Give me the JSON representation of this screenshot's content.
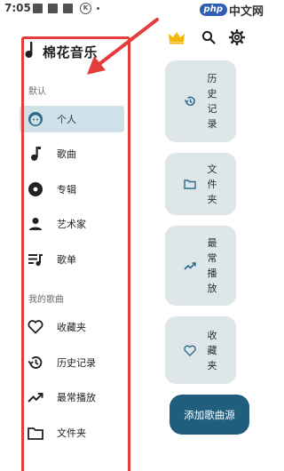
{
  "status_bar": {
    "time": "7:05",
    "notification_badge": "K"
  },
  "watermark": {
    "badge": "php",
    "text": "中文网"
  },
  "drawer": {
    "app_title": "棉花音乐",
    "default_section": "默认",
    "my_songs_section": "我的歌曲",
    "items": [
      {
        "label": "个人",
        "icon": "face-icon",
        "selected": true
      },
      {
        "label": "歌曲",
        "icon": "music-note-icon"
      },
      {
        "label": "专辑",
        "icon": "album-icon"
      },
      {
        "label": "艺术家",
        "icon": "person-icon"
      },
      {
        "label": "歌单",
        "icon": "playlist-icon"
      },
      {
        "label": "收藏夹",
        "icon": "heart-icon"
      },
      {
        "label": "历史记录",
        "icon": "history-icon"
      },
      {
        "label": "最常播放",
        "icon": "trending-icon"
      },
      {
        "label": "文件夹",
        "icon": "folder-icon"
      }
    ]
  },
  "toolbar": {
    "icons": [
      "crown-icon",
      "search-icon",
      "gear-icon"
    ]
  },
  "cards": [
    {
      "text": "历史记录",
      "icon": "history-icon"
    },
    {
      "text": "文件夹",
      "icon": "folder-icon"
    },
    {
      "text": "最常播放",
      "icon": "trending-icon"
    },
    {
      "text": "收藏夹",
      "icon": "heart-icon"
    }
  ],
  "fab": {
    "label": "添加歌曲源"
  },
  "colors": {
    "accent": "#215e7e",
    "selected_bg": "#cfe2ea",
    "card_bg": "#dfe6ea",
    "annotation": "#e53c3c",
    "crown": "#f2b705"
  }
}
